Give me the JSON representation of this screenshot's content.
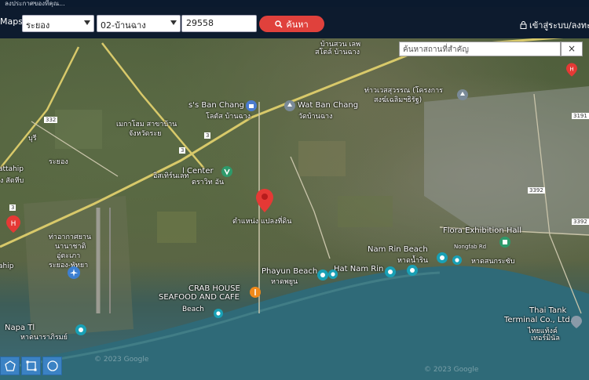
{
  "top_strip": {
    "text": "ลงประกาศของที่คุณ..."
  },
  "navbar": {
    "brand": "Maps",
    "province": "ระยอง",
    "district": "02-บ้านฉาง",
    "code": "29558",
    "search_label": "ค้นหา",
    "login_label": "เข้าสู่ระบบ/ลงทะเบีย"
  },
  "place_search": {
    "placeholder": "ค้นหาสถานที่สำคัญ",
    "close": "×"
  },
  "map": {
    "labels": {
      "bansuan_top": "บ้านสวน เลพ",
      "ban_chang_top": "สโตล์ บ้านฉาง",
      "ss_ban_chang": "s's Ban Chang",
      "ss_ban_chang_sub": "โลตัส บ้านฉาง",
      "wat_ban_chang": "Wat Ban Chang",
      "wat_ban_chang_sub": "วัดบ้านฉาง",
      "thawet": "ท่าวเวสสุวรรณ (โครงการ",
      "thawet2": "สงฆ์เฉลิมฯธิรัฐ)",
      "mueang": "เมกาโฮม สาขาบ้าน",
      "mueang2": "จังหวัดระย",
      "nongbua": "วม",
      "nongbua2": "ระยอง",
      "buri": "บุรี",
      "rayong": "ระยอง",
      "attahip": "attahip",
      "attahip2": "ง สัตหีบ",
      "center": "l Center",
      "center_sub": "อิสเทิร์นเลท",
      "center_sub2": "ตราวิท อัน",
      "airport": "ท่าอากาศยาน",
      "airport2": "นานาชาติ",
      "airport3": "อู่ตะเภา",
      "airport4": "ระยอง-พัทยา",
      "ahip": "ahip",
      "target_pin": "ตำแหน่ง แปลงที่ดิน",
      "flora": "Flora Exhibition Hall",
      "nam_rin": "Nam Rin Beach",
      "nam_rin_sub": "หาดน้ำริน",
      "nongfab": "Nongfab Rd",
      "sanam": "หาดสนกระซับ",
      "phayun": "Phayun Beach",
      "phayun_sub": "หาดพยูน",
      "hat_nam_rin": "Hat Nam Rin",
      "crab1": "CRAB HOUSE",
      "crab2": "SEAFOOD AND CAFE",
      "each": "Beach",
      "napa": "Napa Tl",
      "napa_sub": "หาดนาราภิรมย์",
      "thai_tank": "Thai Tank",
      "thai_tank2": "Terminal Co., Ltd.",
      "thai_tank3": "ไทยแท้งค์",
      "thai_tank4": "เทอร์มินัล",
      "copyright1": "© 2023 Google",
      "copyright2": "© 2023 Google",
      "road_332": "332",
      "road_3": "3",
      "road_3b": "3",
      "road_3c": "3",
      "road_3392a": "3392",
      "road_3392b": "3392",
      "road_3191": "3191"
    }
  },
  "colors": {
    "navbar": "#0d1b2e",
    "search_button": "#e0413c",
    "tool_button": "#3b82c4",
    "pin": "#e53935"
  }
}
